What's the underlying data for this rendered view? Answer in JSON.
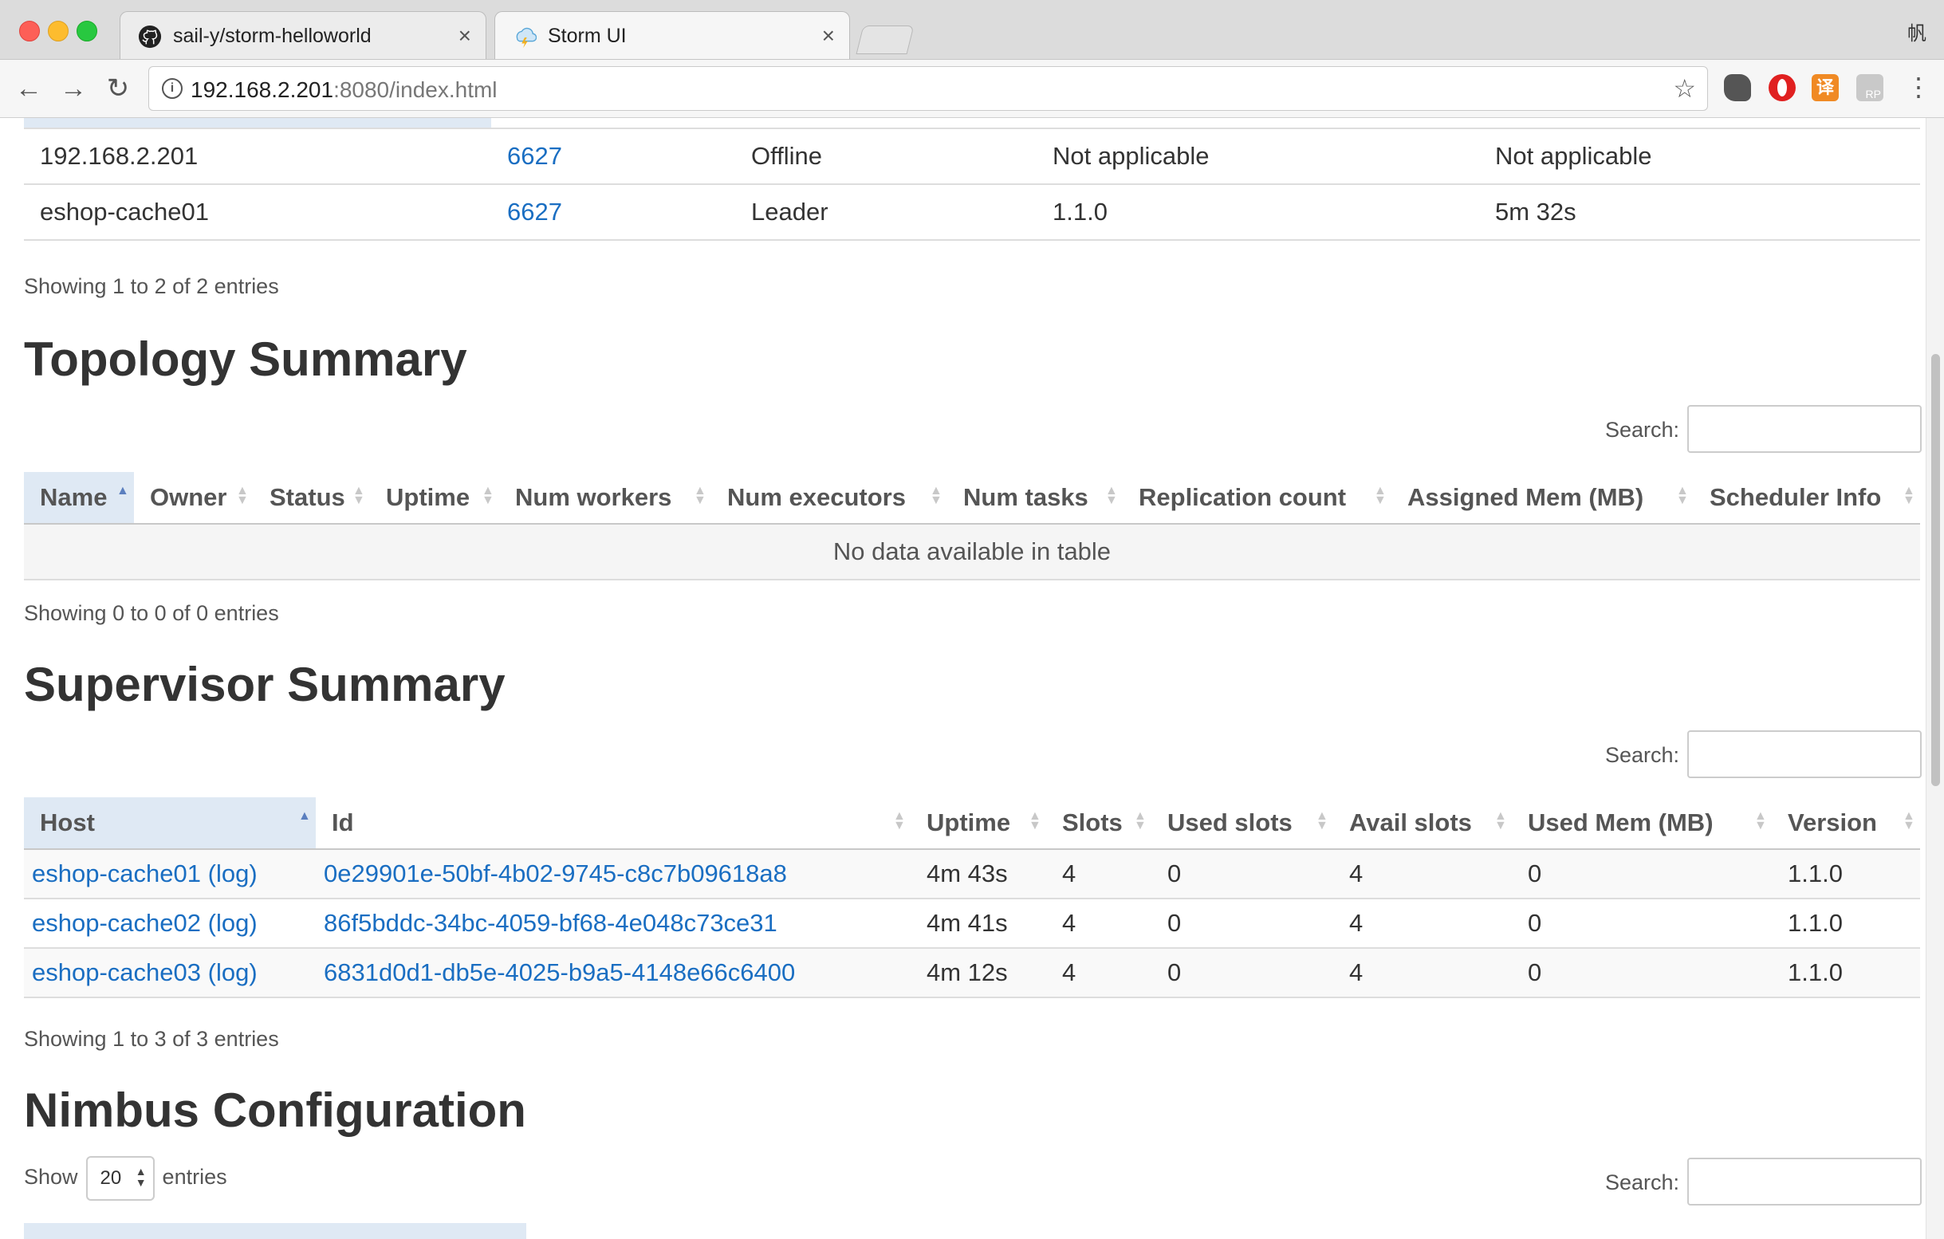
{
  "browser": {
    "tabs": [
      {
        "title": "sail-y/storm-helloworld",
        "icon": "github-icon",
        "active": false
      },
      {
        "title": "Storm UI",
        "icon": "storm-logo-icon",
        "active": true
      }
    ],
    "address": {
      "host": "192.168.2.201",
      "rest": ":8080/index.html"
    },
    "profile_label": "帆",
    "ext_fanyi": "译",
    "ext_rp": "RP"
  },
  "nimbus_summary": {
    "rows": [
      {
        "host": "192.168.2.201",
        "port": "6627",
        "status": "Offline",
        "version": "Not applicable",
        "uptime": "Not applicable"
      },
      {
        "host": "eshop-cache01",
        "port": "6627",
        "status": "Leader",
        "version": "1.1.0",
        "uptime": "5m 32s"
      }
    ],
    "info": "Showing 1 to 2 of 2 entries"
  },
  "topology_summary": {
    "title": "Topology Summary",
    "search_label": "Search:",
    "columns": [
      "Name",
      "Owner",
      "Status",
      "Uptime",
      "Num workers",
      "Num executors",
      "Num tasks",
      "Replication count",
      "Assigned Mem (MB)",
      "Scheduler Info"
    ],
    "empty_message": "No data available in table",
    "info": "Showing 0 to 0 of 0 entries"
  },
  "supervisor_summary": {
    "title": "Supervisor Summary",
    "search_label": "Search:",
    "columns": [
      "Host",
      "Id",
      "Uptime",
      "Slots",
      "Used slots",
      "Avail slots",
      "Used Mem (MB)",
      "Version"
    ],
    "rows": [
      {
        "host": "eshop-cache01",
        "log": "(log)",
        "id": "0e29901e-50bf-4b02-9745-c8c7b09618a8",
        "uptime": "4m 43s",
        "slots": "4",
        "used_slots": "0",
        "avail_slots": "4",
        "used_mem": "0",
        "version": "1.1.0"
      },
      {
        "host": "eshop-cache02",
        "log": "(log)",
        "id": "86f5bddc-34bc-4059-bf68-4e048c73ce31",
        "uptime": "4m 41s",
        "slots": "4",
        "used_slots": "0",
        "avail_slots": "4",
        "used_mem": "0",
        "version": "1.1.0"
      },
      {
        "host": "eshop-cache03",
        "log": "(log)",
        "id": "6831d0d1-db5e-4025-b9a5-4148e66c6400",
        "uptime": "4m 12s",
        "slots": "4",
        "used_slots": "0",
        "avail_slots": "4",
        "used_mem": "0",
        "version": "1.1.0"
      }
    ],
    "info": "Showing 1 to 3 of 3 entries"
  },
  "nimbus_configuration": {
    "title": "Nimbus Configuration",
    "show_label": "Show",
    "page_length": "20",
    "entries_label": "entries",
    "search_label": "Search:"
  }
}
